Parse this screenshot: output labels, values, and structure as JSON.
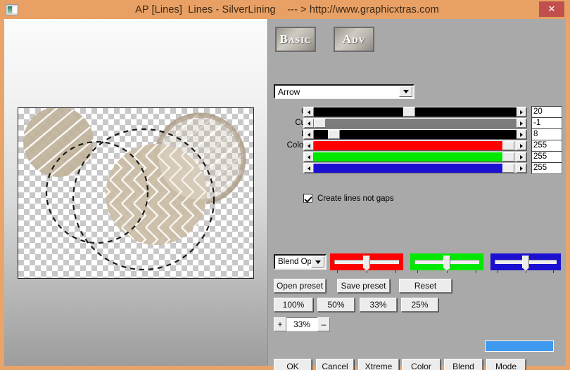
{
  "window": {
    "title": "AP [Lines]  Lines - SilverLining    --- > http://www.graphicxtras.com",
    "close_label": "✕",
    "app_icon": "document-icon"
  },
  "tabs": [
    {
      "id": "basic",
      "label": "Basic",
      "active": true
    },
    {
      "id": "adv",
      "label": "Adv",
      "active": false
    }
  ],
  "shape_combo": {
    "value": "Arrow",
    "arrow_icon": "chevron-down-icon"
  },
  "sliders": [
    {
      "id": "gap",
      "label": "Gap:",
      "value": "20",
      "bar_color": "#000000",
      "bar_mode": "split",
      "thumb_pct": 44
    },
    {
      "id": "cutoff",
      "label": "Cutoff:",
      "value": "-1",
      "bar_color": "#7d7d7d",
      "bar_mode": "right",
      "thumb_pct": 2
    },
    {
      "id": "line",
      "label": "Line:",
      "value": "8",
      "bar_color": "#000000",
      "bar_mode": "split-left",
      "thumb_pct": 8
    },
    {
      "id": "colr",
      "label": "Color[R]:",
      "value": "255",
      "bar_color": "#fe0000",
      "bar_mode": "left",
      "thumb_pct": 94
    },
    {
      "id": "colg",
      "label": "",
      "value": "255",
      "bar_color": "#00e800",
      "bar_mode": "left",
      "thumb_pct": 94
    },
    {
      "id": "colb",
      "label": "",
      "value": "255",
      "bar_color": "#1b0fd0",
      "bar_mode": "left",
      "thumb_pct": 94
    }
  ],
  "checkbox": {
    "label": "Create lines not gaps",
    "checked": true
  },
  "blend_combo": {
    "value": "Blend Opti",
    "arrow_icon": "chevron-down-icon"
  },
  "trackbars": [
    {
      "id": "red",
      "color": "#fe0000",
      "thumb_pct": 45
    },
    {
      "id": "green",
      "color": "#00e800",
      "thumb_pct": 45
    },
    {
      "id": "blue",
      "color": "#1b0fd0",
      "thumb_pct": 45
    }
  ],
  "preset_buttons": {
    "open": "Open preset",
    "save": "Save preset",
    "reset": "Reset"
  },
  "zoom_buttons": [
    "100%",
    "50%",
    "33%",
    "25%"
  ],
  "spinner": {
    "plus": "+",
    "value": "33%",
    "minus": "–"
  },
  "action_buttons": {
    "ok": "OK",
    "cancel": "Cancel",
    "xtreme": "Xtreme",
    "color": "Color",
    "blend": "Blend",
    "mode": "Mode"
  },
  "colors": {
    "title_bar": "#e8a064",
    "close_button": "#c0504d",
    "panel": "#a9a9a9",
    "accent_blue": "#3f99ef",
    "artwork_tan": "#c8bba4"
  },
  "preview": {
    "background": "transparency-checkerboard",
    "description": "Tan circles with white line pattern over transparency grid, with dashed selection circles"
  }
}
